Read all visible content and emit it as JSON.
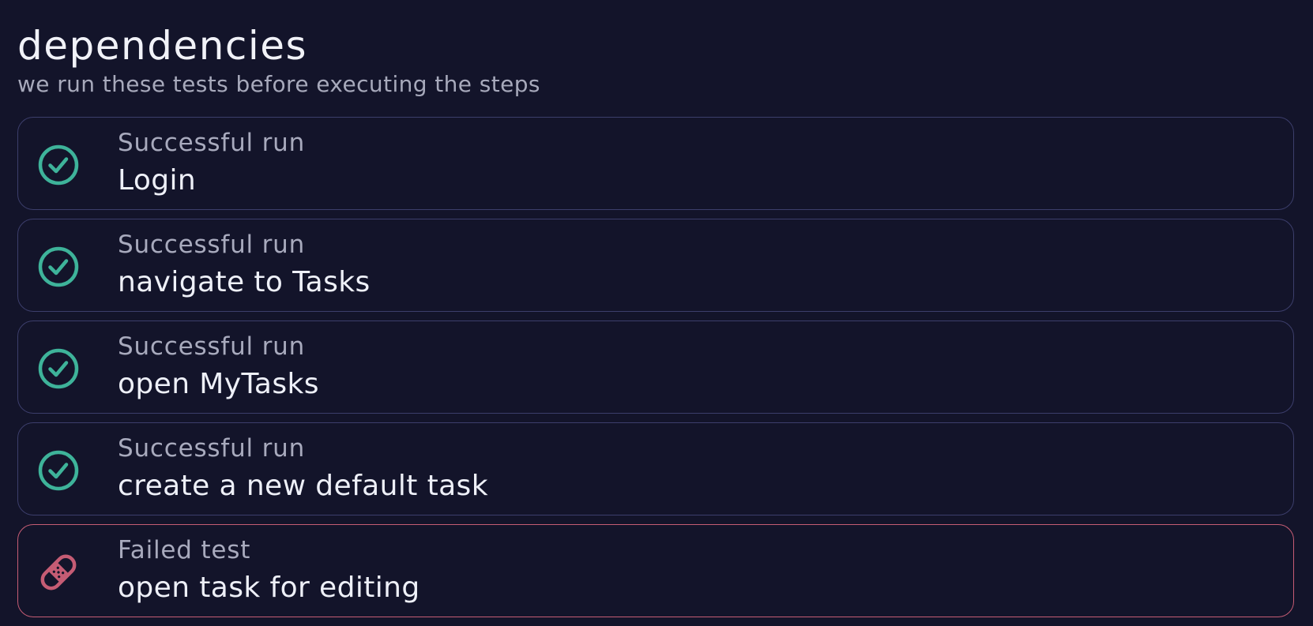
{
  "header": {
    "title": "dependencies",
    "subtitle": "we run these tests before executing the steps"
  },
  "colors": {
    "background": "#13142a",
    "success": "#3eb39a",
    "failure": "#c55c74",
    "card_border": "#3c3e6b"
  },
  "dependencies": [
    {
      "status": "Successful run",
      "name": "Login",
      "icon": "check-circle-icon"
    },
    {
      "status": "Successful run",
      "name": "navigate to Tasks",
      "icon": "check-circle-icon"
    },
    {
      "status": "Successful run",
      "name": "open MyTasks",
      "icon": "check-circle-icon"
    },
    {
      "status": "Successful run",
      "name": "create a new default task",
      "icon": "check-circle-icon"
    },
    {
      "status": "Failed test",
      "name": "open task for editing",
      "icon": "bandage-icon"
    }
  ]
}
